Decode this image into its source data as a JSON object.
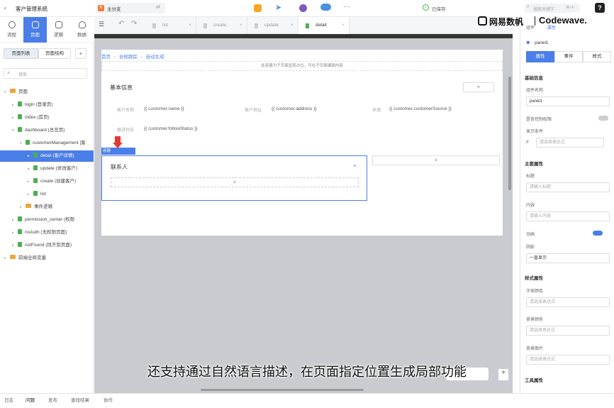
{
  "app": {
    "title": "客户管理系统",
    "branch": "主分支",
    "saved": "已保存",
    "search_placeholder": "搜索关键字",
    "shortcut": "⌘+F",
    "help": "?"
  },
  "left_nav": [
    {
      "label": "流程"
    },
    {
      "label": "页面"
    },
    {
      "label": "逻辑"
    },
    {
      "label": "数据"
    }
  ],
  "panel_tabs": {
    "list": "页面列表",
    "structure": "页面结构",
    "add": "+"
  },
  "tree_search_placeholder": "搜索",
  "tree": [
    {
      "label": "页面",
      "indent": 0,
      "type": "folder",
      "arrow": "▾"
    },
    {
      "label": "login (登录页)",
      "indent": 1,
      "type": "page",
      "arrow": "▸"
    },
    {
      "label": "index (首页)",
      "indent": 1,
      "type": "page",
      "arrow": "▸"
    },
    {
      "label": "dashboard (总览页)",
      "indent": 1,
      "type": "page",
      "arrow": "▾"
    },
    {
      "label": "customerManagement [客",
      "indent": 2,
      "type": "page",
      "arrow": "▾"
    },
    {
      "label": "detail (客户详情)",
      "indent": 3,
      "type": "page",
      "arrow": "▸",
      "selected": true
    },
    {
      "label": "update (修改客户)",
      "indent": 3,
      "type": "page",
      "arrow": "▸"
    },
    {
      "label": "create (创建客户)",
      "indent": 3,
      "type": "page",
      "arrow": "▸"
    },
    {
      "label": "list",
      "indent": 3,
      "type": "page",
      "arrow": "▸"
    },
    {
      "label": "事件逻辑",
      "indent": 2,
      "type": "folder",
      "arrow": "▸"
    },
    {
      "label": "permission_center (权限",
      "indent": 1,
      "type": "page",
      "arrow": "▸"
    },
    {
      "label": "noAuth (无权限页面)",
      "indent": 1,
      "type": "page",
      "arrow": "▸"
    },
    {
      "label": "notFound (找不到页面)",
      "indent": 1,
      "type": "page",
      "arrow": "▸"
    },
    {
      "label": "前端全局变量",
      "indent": 0,
      "type": "folder",
      "arrow": "▸"
    }
  ],
  "editor_tabs": [
    {
      "label": "list"
    },
    {
      "label": "create"
    },
    {
      "label": "update"
    },
    {
      "label": "detail",
      "active": true
    }
  ],
  "breadcrumb": [
    "首页",
    "合规跟踪",
    "自动生成"
  ],
  "canvas": {
    "hint": "此容器为子页面呈现占位，可在子页面编辑内容",
    "section_title": "基本信息",
    "fields": [
      {
        "label": "客户名称",
        "value": "{{ customer.name }}"
      },
      {
        "label": "客户地址",
        "value": "{{ customer.address }}"
      },
      {
        "label": "来源",
        "value": "{{ customer.customerSource }}"
      },
      {
        "label": "跟进状态",
        "value": "{{ customer.followStatus }}"
      }
    ],
    "selected_tag": "容器",
    "contact_title": "联系人",
    "plus": "+"
  },
  "right_panel": {
    "top_tabs": [
      "组件",
      "属性"
    ],
    "component_name": "panel1",
    "sub_tabs": [
      "属性",
      "事件",
      "样式"
    ],
    "sections": {
      "basic": "基础信息",
      "component_name_label": "组件名称",
      "component_name_value": "panel1",
      "permission_label": "是否控制权限",
      "display_label": "显示条件",
      "display_value": "请选择表达式",
      "if_label": "If",
      "main": "主要属性",
      "title_label": "标题",
      "title_placeholder": "请输入标题",
      "content_label": "内容",
      "content_placeholder": "请输入内容",
      "animation_label": "动画",
      "shadow_label": "阴影",
      "shadow_value": "一直显示",
      "style": "样式属性",
      "font_color_label": "字体颜色",
      "font_color_ph": "请选择表达式",
      "bg_color_label": "背景颜色",
      "bg_color_ph": "请选择表达式",
      "bg_image_label": "背景图片",
      "bg_image_ph": "请选择表达式",
      "tool": "工具属性"
    }
  },
  "logo": {
    "brand": "网易数帆",
    "product": "Codewave."
  },
  "subtitle": "还支持通过自然语言描述，在页面指定位置生成局部功能",
  "bottom_tabs": [
    "日志",
    "问题",
    "发布",
    "查找结果",
    "协作"
  ],
  "colors": {
    "accent": "#4a7ee8",
    "selection_border": "#4a7ee8",
    "arrow": "#e53935"
  }
}
